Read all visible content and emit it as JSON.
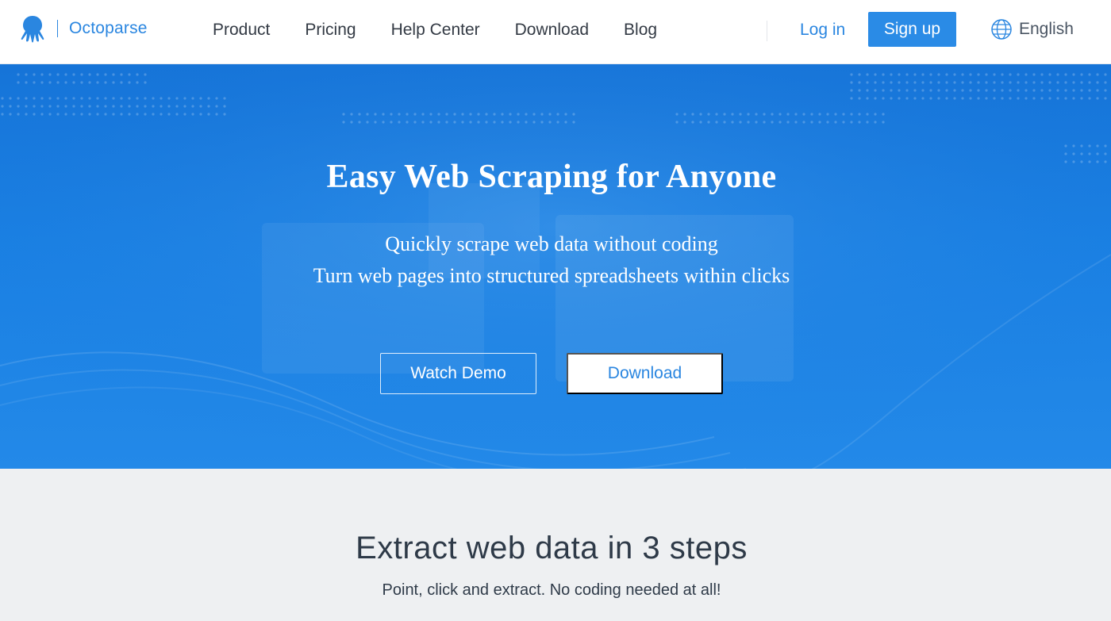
{
  "header": {
    "logo_text": "Octoparse",
    "nav": [
      "Product",
      "Pricing",
      "Help Center",
      "Download",
      "Blog"
    ],
    "login_label": "Log in",
    "signup_label": "Sign up",
    "language_label": "English",
    "language_icon": "globe-icon",
    "logo_icon": "octopus-logo-icon"
  },
  "hero": {
    "title": "Easy Web Scraping for Anyone",
    "subtitle_line1": "Quickly scrape web data without coding",
    "subtitle_line2": "Turn web pages into structured spreadsheets within clicks",
    "watch_demo_label": "Watch Demo",
    "download_label": "Download"
  },
  "steps": {
    "title": "Extract web data in 3 steps",
    "subtitle": "Point, click and extract. No coding needed at all!"
  },
  "colors": {
    "brand": "#2a86e0",
    "hero_background": "#1a80e3",
    "section_background": "#eef0f2",
    "text_dark": "#2e3a48"
  }
}
